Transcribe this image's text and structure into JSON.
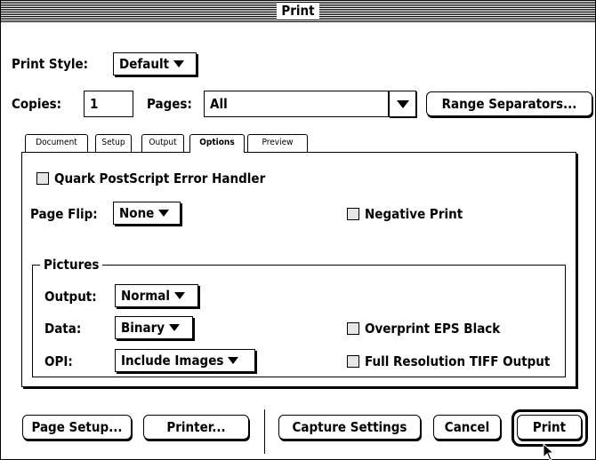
{
  "window": {
    "title": "Print"
  },
  "print_style": {
    "label": "Print Style:",
    "value": "Default"
  },
  "copies": {
    "label": "Copies:",
    "value": "1"
  },
  "pages": {
    "label": "Pages:",
    "value": "All"
  },
  "range_separators": {
    "label": "Range Separators..."
  },
  "tabs": [
    {
      "label": "Document",
      "active": false
    },
    {
      "label": "Setup",
      "active": false
    },
    {
      "label": "Output",
      "active": false
    },
    {
      "label": "Options",
      "active": true
    },
    {
      "label": "Preview",
      "active": false
    }
  ],
  "options": {
    "error_handler": {
      "label": "Quark PostScript Error Handler",
      "checked": false
    },
    "page_flip": {
      "label": "Page Flip:",
      "value": "None"
    },
    "negative_print": {
      "label": "Negative Print",
      "checked": false
    }
  },
  "pictures": {
    "title": "Pictures",
    "output": {
      "label": "Output:",
      "value": "Normal"
    },
    "data": {
      "label": "Data:",
      "value": "Binary"
    },
    "opi": {
      "label": "OPI:",
      "value": "Include Images"
    },
    "overprint_eps": {
      "label": "Overprint EPS Black",
      "checked": false
    },
    "full_res_tiff": {
      "label": "Full Resolution TIFF Output",
      "checked": false
    }
  },
  "buttons": {
    "page_setup": "Page Setup...",
    "printer": "Printer...",
    "capture_settings": "Capture Settings",
    "cancel": "Cancel",
    "print": "Print"
  },
  "icons": {
    "popup_arrow": "down-triangle-icon",
    "cursor": "arrow-cursor-icon"
  }
}
